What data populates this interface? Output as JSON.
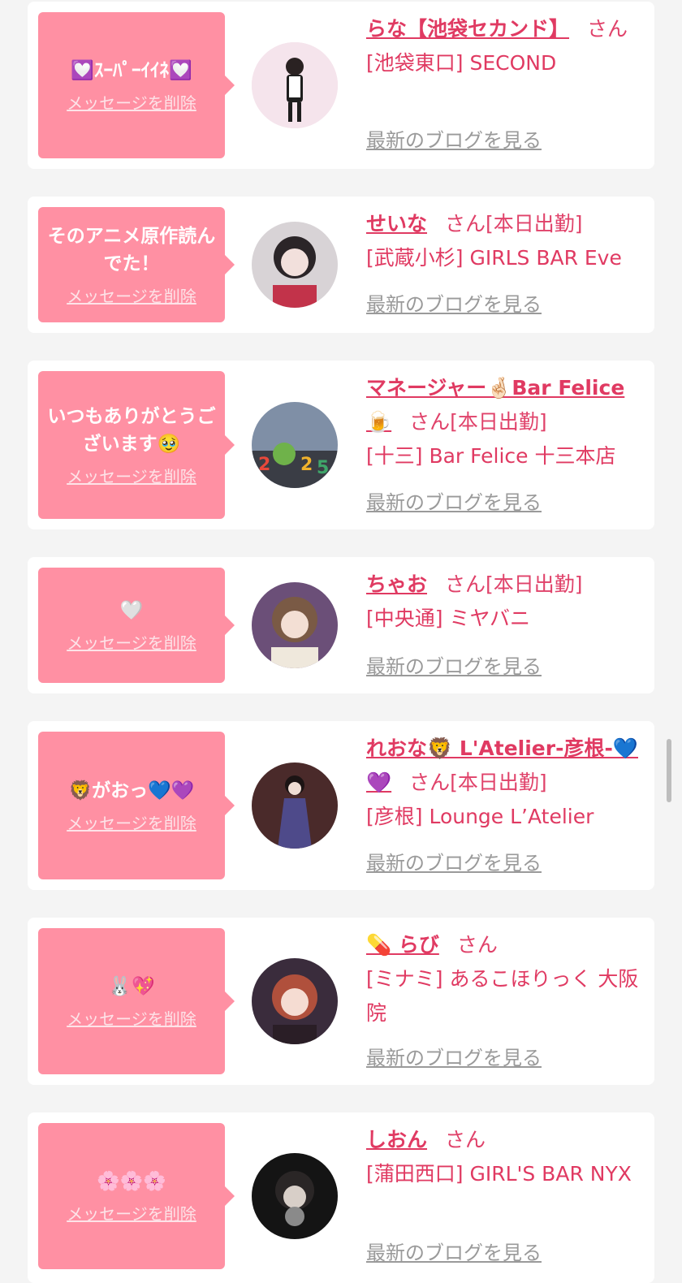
{
  "delete_label": "メッセージを削除",
  "blog_label": "最新のブログを見る",
  "san_label": "さん",
  "colors": {
    "background": "#f4f4f4",
    "card": "#ffffff",
    "bubble": "#ff90a3",
    "accent": "#e03a62",
    "muted": "#9a9a9a"
  },
  "items": [
    {
      "message": "💟ｽｰﾊﾟｰｲｲﾈ💟",
      "name": "らな【池袋セカンド】",
      "status": "",
      "shop": "[池袋東口] SECOND",
      "avatar_icon": "avatar-maid"
    },
    {
      "message": "そのアニメ原作読んでた！",
      "name": "せいな",
      "status": "[本日出勤]",
      "shop": "[武蔵小杉] GIRLS BAR Eve",
      "avatar_icon": "avatar-girl"
    },
    {
      "message": "いつもありがとうございます🥹",
      "name": "マネージャー🤞🏻Bar Felice🍺",
      "status": "[本日出勤]",
      "shop": "[十三] Bar Felice 十三本店",
      "avatar_icon": "avatar-2025"
    },
    {
      "message": "🤍",
      "name": "ちゃお",
      "status": "[本日出勤]",
      "shop": "[中央通] ミヤバニ",
      "avatar_icon": "avatar-girl"
    },
    {
      "message": "🦁がおっ💙💜",
      "name": "れおな🦁 L'Atelier-彦根-💙💜",
      "status": "[本日出勤]",
      "shop": "[彦根] Lounge L’Atelier",
      "avatar_icon": "avatar-dress"
    },
    {
      "message": "🐰💖",
      "name": "💊 らび",
      "status": "",
      "shop": "[ミナミ] あるこほりっく 大阪院",
      "avatar_icon": "avatar-girl"
    },
    {
      "message": "🌸🌸🌸",
      "name": "しおん",
      "status": "",
      "shop": "[蒲田西口] GIRL'S BAR NYX",
      "avatar_icon": "avatar-dark"
    }
  ]
}
